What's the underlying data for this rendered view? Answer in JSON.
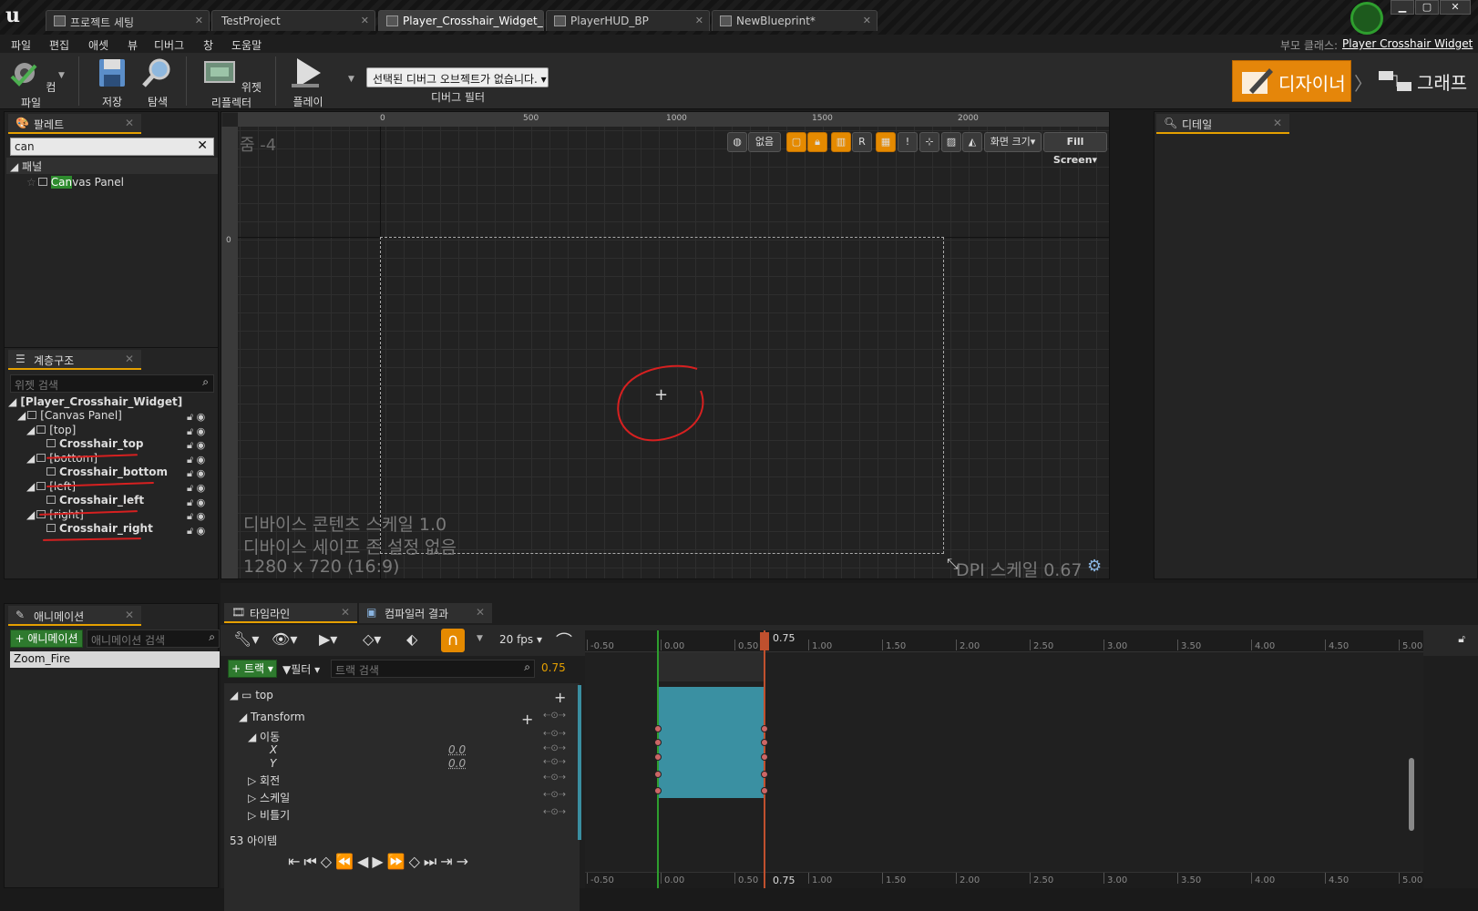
{
  "tabs": [
    {
      "label": "프로젝트 세팅",
      "active": false
    },
    {
      "label": "TestProject",
      "active": false
    },
    {
      "label": "Player_Crosshair_Widget_",
      "active": true
    },
    {
      "label": "PlayerHUD_BP",
      "active": false
    },
    {
      "label": "NewBlueprint*",
      "active": false
    }
  ],
  "menu": [
    "파일",
    "편집",
    "애셋",
    "뷰",
    "디버그",
    "창",
    "도움말"
  ],
  "parent_class": {
    "label": "부모 클래스:",
    "value": "Player Crosshair Widget"
  },
  "toolbar": {
    "compile": "컴파일",
    "save": "저장",
    "browse": "탐색",
    "widget_reflector": "위젯 리플렉터",
    "play": "플레이",
    "debug_select": "선택된 디버그 오브젝트가 없습니다.",
    "debug_filter": "디버그 필터",
    "designer": "디자이너",
    "graph": "그래프"
  },
  "palette": {
    "title": "팔레트",
    "search_value": "can",
    "category": "패널",
    "item_highlight": "Can",
    "item_rest": "vas Panel"
  },
  "hierarchy": {
    "title": "계층구조",
    "search_placeholder": "위젯 검색",
    "items": [
      {
        "label": "[Player_Crosshair_Widget]"
      },
      {
        "label": "[Canvas Panel]"
      },
      {
        "label": "[top]"
      },
      {
        "label": "Crosshair_top"
      },
      {
        "label": "[bottom]"
      },
      {
        "label": "Crosshair_bottom"
      },
      {
        "label": "[left]"
      },
      {
        "label": "Crosshair_left"
      },
      {
        "label": "[right]"
      },
      {
        "label": "Crosshair_right"
      }
    ]
  },
  "details": {
    "title": "디테일"
  },
  "designer": {
    "zoom": "줌 -4",
    "ruler_ticks": [
      "0",
      "500",
      "1000",
      "1500",
      "2000"
    ],
    "ruler_v": "0",
    "none_btn": "없음",
    "r_btn": "R",
    "screen_size": "화면 크기",
    "fill_screen": "Fill Screen",
    "overlay1": "디바이스 콘텐츠 스케일 1.0",
    "overlay2": "디바이스 세이프 존 설정 없음",
    "overlay3": "1280 x 720 (16:9)",
    "dpi": "DPI 스케일 0.67"
  },
  "animations": {
    "title": "애니메이션",
    "add": "+ 애니메이션",
    "search_placeholder": "애니메이션 검색",
    "items": [
      "Zoom_Fire"
    ]
  },
  "timeline": {
    "tab1": "타임라인",
    "tab2": "컴파일러 결과",
    "fps": "20 fps",
    "track_btn": "+ 트랙",
    "filter_btn": "필터",
    "track_search_placeholder": "트랙 검색",
    "current_time": "0.75",
    "rows": [
      {
        "label": "top"
      },
      {
        "label": "Transform"
      },
      {
        "label": "이동"
      },
      {
        "label": "X",
        "value": "0.0"
      },
      {
        "label": "Y",
        "value": "0.0"
      },
      {
        "label": "회전"
      },
      {
        "label": "스케일"
      },
      {
        "label": "비틀기"
      }
    ],
    "item_count": "53 아이템",
    "ticks": [
      "-0.50",
      "0.00",
      "0.50",
      "1.00",
      "1.50",
      "2.00",
      "2.50",
      "3.00",
      "3.50",
      "4.00",
      "4.50",
      "5.00"
    ]
  }
}
